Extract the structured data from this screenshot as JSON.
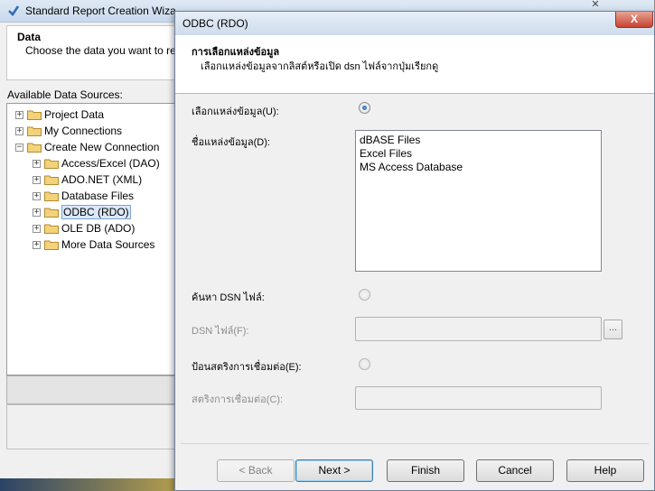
{
  "wizard": {
    "title": "Standard Report Creation Wiza",
    "close_glyph": "✕",
    "header_title": "Data",
    "header_subtitle": "Choose the data you want to re",
    "sources_label": "Available Data Sources:",
    "tree": [
      {
        "label": "Project Data",
        "expander": "+",
        "level": 0
      },
      {
        "label": "My Connections",
        "expander": "+",
        "level": 0
      },
      {
        "label": "Create New Connection",
        "expander": "−",
        "level": 0
      },
      {
        "label": "Access/Excel (DAO)",
        "expander": "+",
        "level": 1
      },
      {
        "label": "ADO.NET (XML)",
        "expander": "+",
        "level": 1
      },
      {
        "label": "Database Files",
        "expander": "+",
        "level": 1
      },
      {
        "label": "ODBC (RDO)",
        "expander": "+",
        "level": 1,
        "selected": true
      },
      {
        "label": "OLE DB (ADO)",
        "expander": "+",
        "level": 1
      },
      {
        "label": "More Data Sources",
        "expander": "+",
        "level": 1
      }
    ]
  },
  "dialog": {
    "title": "ODBC (RDO)",
    "close_glyph": "X",
    "header_title": "การเลือกแหล่งข้อมูล",
    "header_subtitle": "เลือกแหล่งข้อมูลจากลิสต์หรือเปิด dsn ไฟล์จากปุ่มเรียกดู",
    "select_source_label": "เลือกแหล่งข้อมูล(U):",
    "source_name_label": "ชื่อแหล่งข้อมูล(D):",
    "data_sources": [
      "dBASE Files",
      "Excel Files",
      "MS Access Database"
    ],
    "find_dsn_label": "ค้นหา DSN ไฟล์:",
    "dsn_file_label": "DSN ไฟล์(F):",
    "dsn_file_value": "",
    "browse_label": "...",
    "connection_string_option_label": "ป้อนสตริงการเชื่อมต่อ(E):",
    "connection_string_label": "สตริงการเชื่อมต่อ(C):",
    "connection_string_value": "",
    "buttons": {
      "back": "< Back",
      "next": "Next >",
      "finish": "Finish",
      "cancel": "Cancel",
      "help": "Help"
    }
  }
}
